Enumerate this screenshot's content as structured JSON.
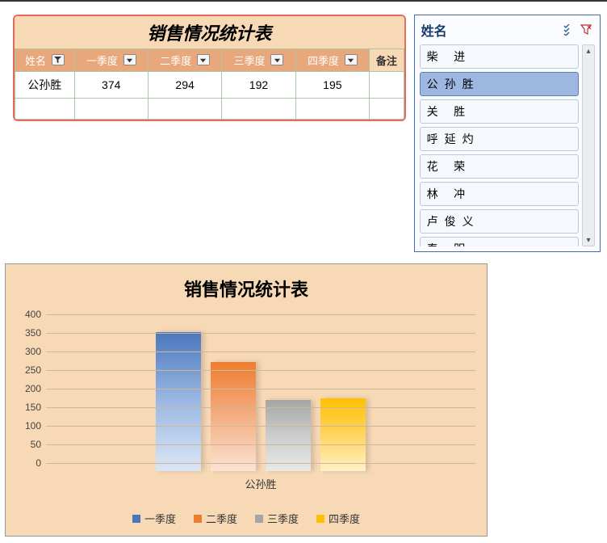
{
  "table": {
    "title": "销售情况统计表",
    "headers": {
      "name": "姓名",
      "q1": "一季度",
      "q2": "二季度",
      "q3": "三季度",
      "q4": "四季度",
      "remark": "备注"
    },
    "rows": [
      {
        "name": "公孙胜",
        "q1": "374",
        "q2": "294",
        "q3": "192",
        "q4": "195",
        "remark": ""
      }
    ]
  },
  "slicer": {
    "title": "姓名",
    "items": [
      "柴    进",
      "公孙胜",
      "关    胜",
      "呼延灼",
      "花    荣",
      "林    冲",
      "卢俊义",
      "秦    明"
    ],
    "selected_index": 1
  },
  "chart_data": {
    "type": "bar",
    "title": "销售情况统计表",
    "categories": [
      "公孙胜"
    ],
    "series": [
      {
        "name": "一季度",
        "values": [
          374
        ]
      },
      {
        "name": "二季度",
        "values": [
          294
        ]
      },
      {
        "name": "三季度",
        "values": [
          192
        ]
      },
      {
        "name": "四季度",
        "values": [
          195
        ]
      }
    ],
    "ylim": [
      0,
      400
    ],
    "y_ticks": [
      0,
      50,
      100,
      150,
      200,
      250,
      300,
      350,
      400
    ]
  }
}
